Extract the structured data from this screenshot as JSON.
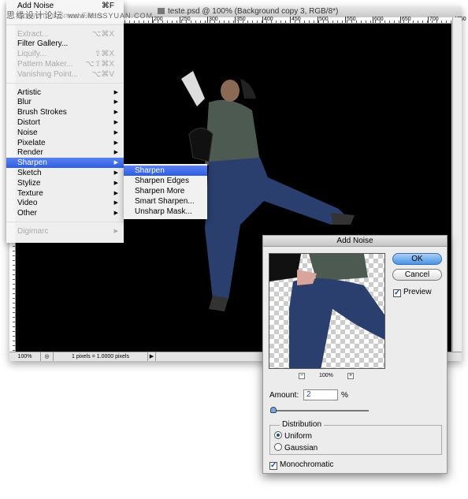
{
  "watermark": {
    "cn": "思缘设计论坛",
    "url": "www.MISSYUAN.COM"
  },
  "document": {
    "title": "teste.psd @ 100% (Background copy 3, RGB/8*)",
    "ruler_ticks": [
      "200",
      "250",
      "300",
      "350",
      "400",
      "450",
      "500",
      "550",
      "600",
      "650",
      "700",
      "750"
    ],
    "status": {
      "zoom": "100%",
      "info": "1 pixels = 1.0000 pixels"
    }
  },
  "filter_menu": {
    "items": [
      {
        "label": "Add Noise",
        "shortcut": "⌘F",
        "enabled": true
      },
      {
        "label": "Convert for Smart Filters",
        "enabled": false
      },
      {
        "sep": true
      },
      {
        "label": "Extract...",
        "shortcut": "⌥⌘X",
        "enabled": false
      },
      {
        "label": "Filter Gallery...",
        "enabled": true
      },
      {
        "label": "Liquify...",
        "shortcut": "⇧⌘X",
        "enabled": false
      },
      {
        "label": "Pattern Maker...",
        "shortcut": "⌥⇧⌘X",
        "enabled": false
      },
      {
        "label": "Vanishing Point...",
        "shortcut": "⌥⌘V",
        "enabled": false
      },
      {
        "sep": true
      },
      {
        "label": "Artistic",
        "submenu": true,
        "enabled": true
      },
      {
        "label": "Blur",
        "submenu": true,
        "enabled": true
      },
      {
        "label": "Brush Strokes",
        "submenu": true,
        "enabled": true
      },
      {
        "label": "Distort",
        "submenu": true,
        "enabled": true
      },
      {
        "label": "Noise",
        "submenu": true,
        "enabled": true
      },
      {
        "label": "Pixelate",
        "submenu": true,
        "enabled": true
      },
      {
        "label": "Render",
        "submenu": true,
        "enabled": true
      },
      {
        "label": "Sharpen",
        "submenu": true,
        "enabled": true,
        "highlighted": true
      },
      {
        "label": "Sketch",
        "submenu": true,
        "enabled": true
      },
      {
        "label": "Stylize",
        "submenu": true,
        "enabled": true
      },
      {
        "label": "Texture",
        "submenu": true,
        "enabled": true
      },
      {
        "label": "Video",
        "submenu": true,
        "enabled": true
      },
      {
        "label": "Other",
        "submenu": true,
        "enabled": true
      },
      {
        "sep": true
      },
      {
        "label": "Digimarc",
        "submenu": true,
        "enabled": false
      }
    ]
  },
  "sharpen_submenu": {
    "items": [
      "Sharpen",
      "Sharpen Edges",
      "Sharpen More",
      "Smart Sharpen...",
      "Unsharp Mask..."
    ],
    "highlighted": 0
  },
  "dialog": {
    "title": "Add Noise",
    "ok": "OK",
    "cancel": "Cancel",
    "preview_label": "Preview",
    "preview_checked": true,
    "zoom": "100%",
    "zoom_out": "−",
    "zoom_in": "+",
    "amount_label": "Amount:",
    "amount_value": "2",
    "amount_unit": "%",
    "amount_percent": 2,
    "distribution_label": "Distribution",
    "uniform": "Uniform",
    "gaussian": "Gaussian",
    "selected_distribution": "Uniform",
    "monochromatic": "Monochromatic",
    "monochromatic_checked": true
  },
  "colors": {
    "highlight": "#3d6ee8",
    "jeans": "#2a3f6e",
    "ok_button": "#4a93e6"
  }
}
